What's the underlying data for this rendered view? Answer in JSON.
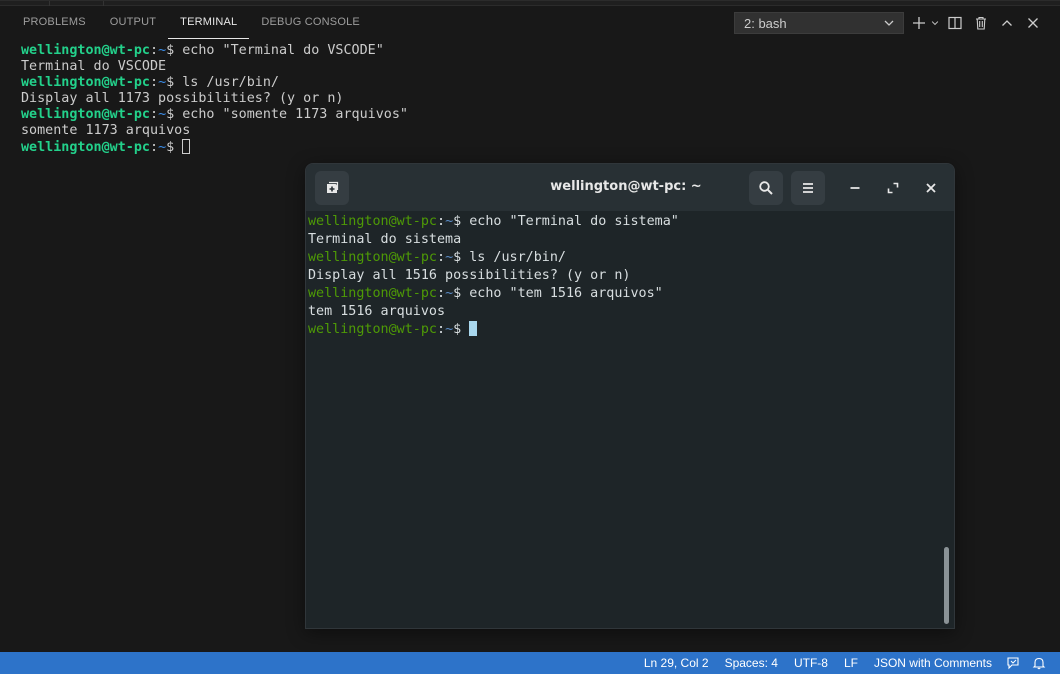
{
  "panel": {
    "tabs": [
      {
        "label": "PROBLEMS"
      },
      {
        "label": "OUTPUT"
      },
      {
        "label": "TERMINAL",
        "active": true
      },
      {
        "label": "DEBUG CONSOLE"
      }
    ],
    "terminal_select": "2: bash",
    "icons": [
      "plus-icon",
      "chevron-down-icon",
      "split-terminal-icon",
      "trash-icon",
      "chevron-up-icon",
      "close-icon"
    ]
  },
  "vscode_terminal": {
    "prompt_user": "wellington@wt-pc",
    "prompt_path": "~",
    "lines": [
      {
        "cmd": "echo \"Terminal do VSCODE\""
      },
      {
        "out": "Terminal do VSCODE"
      },
      {
        "cmd": "ls /usr/bin/"
      },
      {
        "out": "Display all 1173 possibilities? (y or n)"
      },
      {
        "cmd": "echo \"somente 1173 arquivos\""
      },
      {
        "out": "somente 1173 arquivos"
      },
      {
        "cmd": ""
      }
    ]
  },
  "gnome_terminal": {
    "title": "wellington@wt-pc: ~",
    "prompt_user": "wellington@wt-pc",
    "prompt_path": "~",
    "lines": [
      {
        "cmd": "echo \"Terminal do sistema\""
      },
      {
        "out": "Terminal do sistema"
      },
      {
        "cmd": "ls /usr/bin/"
      },
      {
        "out": "Display all 1516 possibilities? (y or n)"
      },
      {
        "cmd": "echo \"tem 1516 arquivos\""
      },
      {
        "out": "tem 1516 arquivos"
      },
      {
        "cmd": ""
      }
    ]
  },
  "status_bar": {
    "position": "Ln 29, Col 2",
    "spaces": "Spaces: 4",
    "encoding": "UTF-8",
    "eol": "LF",
    "language": "JSON with Comments",
    "color": "#2d73c9"
  }
}
